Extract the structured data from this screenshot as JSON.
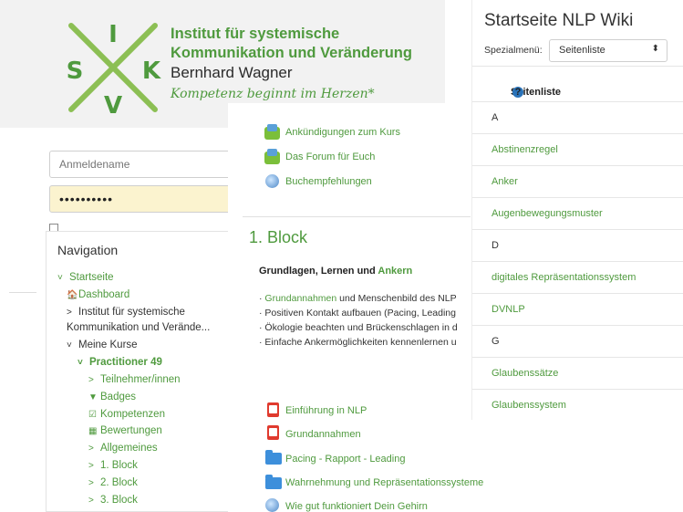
{
  "logo": {
    "letters": {
      "top": "I",
      "left": "S",
      "right": "K",
      "bottom": "V"
    },
    "institute_line1": "Institut für systemische",
    "institute_line2": "Kommunikation und Veränderung",
    "name": "Bernhard Wagner",
    "tagline": "Kompetenz beginnt im Herzen*"
  },
  "login": {
    "username_placeholder": "Anmeldename",
    "password_value": "••••••••••"
  },
  "navigation": {
    "title": "Navigation",
    "items": [
      {
        "icon": "˅",
        "label": "Startseite"
      },
      {
        "icon": "🏠",
        "label": "Dashboard"
      },
      {
        "icon": ">",
        "label": "Institut für systemische"
      },
      {
        "icon": "",
        "label": "Kommunikation und Verände..."
      },
      {
        "icon": "˅",
        "label": "Meine Kurse"
      },
      {
        "icon": "˅",
        "label": "Practitioner 49"
      },
      {
        "icon": ">",
        "label": "Teilnehmer/innen"
      },
      {
        "icon": "▼",
        "label": "Badges"
      },
      {
        "icon": "☑",
        "label": "Kompetenzen"
      },
      {
        "icon": "▦",
        "label": "Bewertungen"
      },
      {
        "icon": ">",
        "label": "Allgemeines"
      },
      {
        "icon": ">",
        "label": "1. Block"
      },
      {
        "icon": ">",
        "label": "2. Block"
      },
      {
        "icon": ">",
        "label": "3. Block"
      }
    ]
  },
  "course": {
    "top_links": [
      "Ankündigungen zum Kurs",
      "Das Forum für Euch",
      "Buchempfehlungen"
    ],
    "section_title": "1. Block",
    "subtitle_prefix": "Grundlagen, Lernen und ",
    "subtitle_link": "Ankern",
    "bullets": [
      {
        "link": "Grundannahmen",
        "text": " und Menschenbild des NLP"
      },
      {
        "link": "",
        "text": "Positiven Kontakt aufbauen (Pacing, Leading"
      },
      {
        "link": "",
        "text": "Ökologie beachten und Brückenschlagen in d"
      },
      {
        "link": "",
        "text": "Einfache Ankermöglichkeiten kennenlernen u"
      }
    ],
    "resources": [
      {
        "icon": "pdf-icon",
        "label": "Einführung in NLP"
      },
      {
        "icon": "pdf-icon",
        "label": "Grundannahmen"
      },
      {
        "icon": "folder-icon",
        "label": "Pacing - Rapport - Leading"
      },
      {
        "icon": "folder-icon",
        "label": "Wahrnehmung und Repräsentationssysteme"
      },
      {
        "icon": "globe-icon",
        "label": "Wie gut funktioniert Dein Gehirn"
      }
    ]
  },
  "wiki": {
    "title": "Startseite NLP Wiki",
    "menu_label": "Spezialmenü:",
    "select_value": "Seitenliste",
    "list_header": "Seitenliste",
    "rows": [
      {
        "kind": "letter",
        "text": "A"
      },
      {
        "kind": "link",
        "text": "Abstinenzregel"
      },
      {
        "kind": "link",
        "text": "Anker"
      },
      {
        "kind": "link",
        "text": "Augenbewegungsmuster"
      },
      {
        "kind": "letter",
        "text": "D"
      },
      {
        "kind": "link",
        "text": "digitales Repräsentationssystem"
      },
      {
        "kind": "link",
        "text": "DVNLP"
      },
      {
        "kind": "letter",
        "text": "G"
      },
      {
        "kind": "link",
        "text": "Glaubenssätze"
      },
      {
        "kind": "link",
        "text": "Glaubenssystem"
      }
    ]
  },
  "colors": {
    "brand_green": "#4f9a3e",
    "link_green": "#4f9a3e"
  }
}
